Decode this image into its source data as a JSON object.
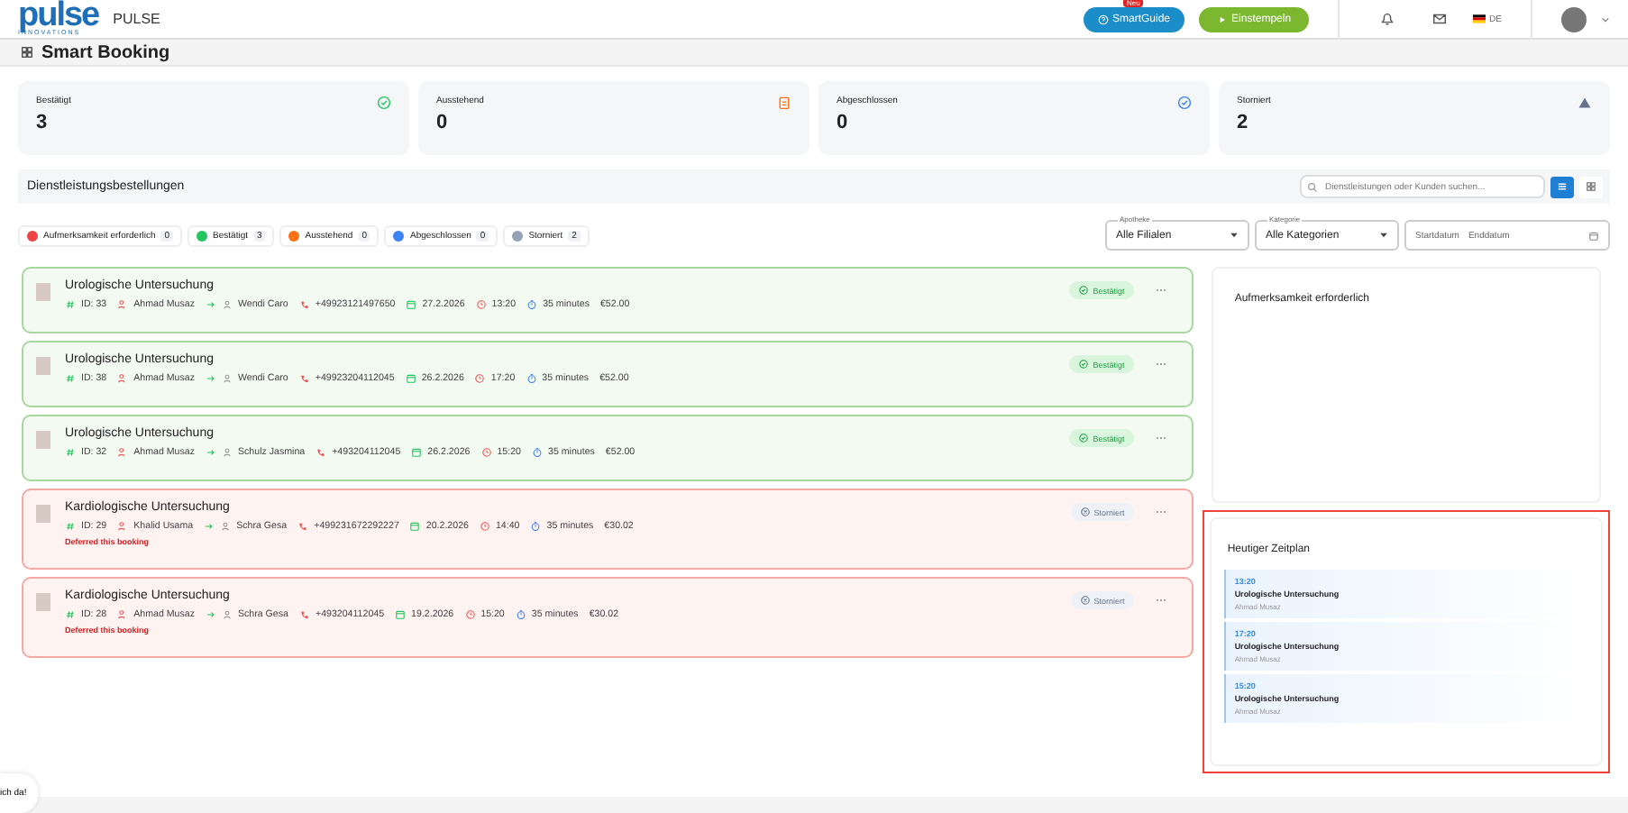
{
  "header": {
    "logo": "pulse",
    "logo_sub": "INNOVATIONS",
    "app_name": "PULSE",
    "smartguide": {
      "label": "SmartGuide",
      "badge": "Neu"
    },
    "clock_in": "Einstempeln",
    "language": "DE"
  },
  "page_title": "Smart Booking",
  "stats": [
    {
      "label": "Bestätigt",
      "value": "3",
      "kind": "confirmed"
    },
    {
      "label": "Ausstehend",
      "value": "0",
      "kind": "pending"
    },
    {
      "label": "Abgeschlossen",
      "value": "0",
      "kind": "completed"
    },
    {
      "label": "Storniert",
      "value": "2",
      "kind": "cancelled"
    }
  ],
  "section": {
    "title": "Dienstleistungsbestellungen",
    "search": {
      "placeholder": "Dienstleistungen oder Kunden suchen..."
    },
    "views": [
      {
        "kind": "list",
        "selected": true
      },
      {
        "kind": "grid",
        "selected": false
      }
    ]
  },
  "legend": [
    {
      "label": "Aufmerksamkeit erforderlich",
      "count": "0",
      "color": "#ef4444"
    },
    {
      "label": "Bestätigt",
      "count": "3",
      "color": "#22c55e"
    },
    {
      "label": "Ausstehend",
      "count": "0",
      "color": "#f97316"
    },
    {
      "label": "Abgeschlossen",
      "count": "0",
      "color": "#3b82f6"
    },
    {
      "label": "Storniert",
      "count": "2",
      "color": "#94a3b8"
    }
  ],
  "filters": [
    {
      "label": "Apotheke",
      "value": "Alle Filialen"
    },
    {
      "label": "Kategorie",
      "value": "Alle Kategorien"
    }
  ],
  "date_range": {
    "start": "Startdatum",
    "end": "Enddatum"
  },
  "bookings": [
    {
      "title": "Urologische Untersuchung",
      "id": "ID: 33",
      "staff": "Ahmad Musaz",
      "customer": "Wendi Caro",
      "phone": "+49923121497650",
      "date": "27.2.2026",
      "time": "13:20",
      "duration": "35 minutes",
      "price": "€52.00",
      "status": "Bestätigt",
      "kind": "confirmed"
    },
    {
      "title": "Urologische Untersuchung",
      "id": "ID: 38",
      "staff": "Ahmad Musaz",
      "customer": "Wendi Caro",
      "phone": "+49923204112045",
      "date": "26.2.2026",
      "time": "17:20",
      "duration": "35 minutes",
      "price": "€52.00",
      "status": "Bestätigt",
      "kind": "confirmed"
    },
    {
      "title": "Urologische Untersuchung",
      "id": "ID: 32",
      "staff": "Ahmad Musaz",
      "customer": "Schulz Jasmina",
      "phone": "+493204112045",
      "date": "26.2.2026",
      "time": "15:20",
      "duration": "35 minutes",
      "price": "€52.00",
      "status": "Bestätigt",
      "kind": "confirmed"
    },
    {
      "title": "Kardiologische Untersuchung",
      "id": "ID: 29",
      "staff": "Khalid Usama",
      "customer": "Schra Gesa",
      "phone": "+499231672292227",
      "date": "20.2.2026",
      "time": "14:40",
      "duration": "35 minutes",
      "price": "€30.02",
      "status": "Storniert",
      "kind": "cancelled",
      "note": "Deferred this booking"
    },
    {
      "title": "Kardiologische Untersuchung",
      "id": "ID: 28",
      "staff": "Ahmad Musaz",
      "customer": "Schra Gesa",
      "phone": "+493204112045",
      "date": "19.2.2026",
      "time": "15:20",
      "duration": "35 minutes",
      "price": "€30.02",
      "status": "Storniert",
      "kind": "cancelled",
      "note": "Deferred this booking"
    }
  ],
  "attention": {
    "title": "Aufmerksamkeit erforderlich"
  },
  "schedule": {
    "title": "Heutiger Zeitplan",
    "highlighted": true,
    "items": [
      {
        "time": "13:20",
        "title": "Urologische Untersuchung",
        "staff": "Ahmad Musaz"
      },
      {
        "time": "17:20",
        "title": "Urologische Untersuchung",
        "staff": "Ahmad Musaz"
      },
      {
        "time": "15:20",
        "title": "Urologische Untersuchung",
        "staff": "Ahmad Musaz"
      }
    ]
  },
  "chat_bubble": "ich da!"
}
